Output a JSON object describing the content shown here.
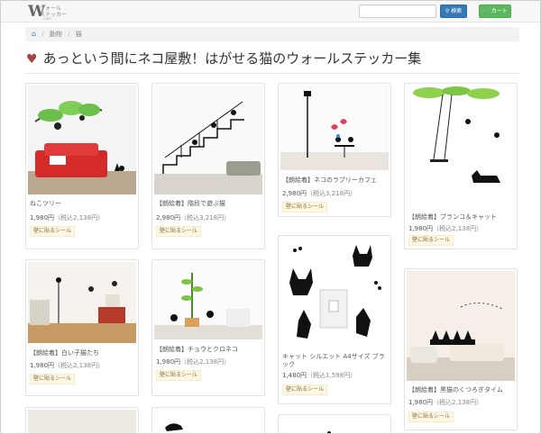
{
  "header": {
    "logo_letter": "W",
    "logo_line1": "ウォール",
    "logo_line2": "ステッカー",
    "logo_line3": ".com",
    "search_placeholder": "",
    "search_button": "検索",
    "cart_button": "カート",
    "colors": {
      "search": "#337ab7",
      "cart": "#5cb85c"
    }
  },
  "breadcrumb": {
    "home_icon": "home-icon",
    "items": [
      "動物",
      "猫"
    ]
  },
  "page": {
    "heart_icon": "♥",
    "title": "あっという間にネコ屋敷！はがせる猫のウォールステッカー集"
  },
  "products": [
    {
      "name": "ねこツリー",
      "price": "1,980円",
      "tax": "（税込2,138円）",
      "tag": "壁に貼るシール",
      "icon": "cat-tree-sticker"
    },
    {
      "name": "【朗絵着】階段で遊ぶ猫",
      "price": "2,980円",
      "tax": "（税込3,218円）",
      "tag": "壁に貼るシール",
      "icon": "cat-stairs-sticker"
    },
    {
      "name": "【朗絵着】ネコのラブリーカフェ",
      "price": "2,980円",
      "tax": "（税込3,218円）",
      "tag": "壁に貼るシール",
      "icon": "cat-cafe-sticker"
    },
    {
      "name": "【朗絵着】ブランコ＆キャット",
      "price": "1,980円",
      "tax": "（税込2,138円）",
      "tag": "壁に貼るシール",
      "icon": "swing-cat-sticker"
    },
    {
      "name": "【朗絵着】白い子猫たち",
      "price": "1,980円",
      "tax": "（税込2,138円）",
      "tag": "壁に貼るシール",
      "icon": "white-kittens-sticker"
    },
    {
      "name": "【朗絵着】チョウとクロネコ",
      "price": "1,980円",
      "tax": "（税込2,138円）",
      "tag": "壁に貼るシール",
      "icon": "butterfly-cat-sticker"
    },
    {
      "name": "キャット シルエット A4サイズ ブラック",
      "price": "1,480円",
      "tax": "（税込1,598円）",
      "tag": "壁に貼るシール",
      "icon": "cat-silhouette-switch-sticker"
    },
    {
      "name": "【朗絵着】黒猫のくつろぎタイム",
      "price": "1,980円",
      "tax": "（税込2,138円）",
      "tag": "壁に貼るシール",
      "icon": "black-cats-relax-sticker"
    }
  ]
}
